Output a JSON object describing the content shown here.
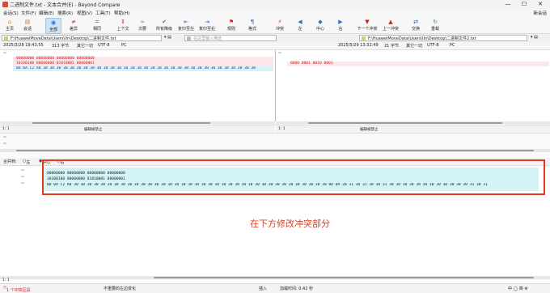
{
  "window": {
    "title": "二进制文件.txt - 文本合并(E) - Beyond Compare",
    "controls": [
      "—",
      "☐",
      "✕"
    ]
  },
  "menubar": {
    "items": [
      "会话(S)",
      "文件(F)",
      "编辑(E)",
      "搜索(R)",
      "视图(V)",
      "工具(T)",
      "帮助(H)"
    ],
    "right": "新会话"
  },
  "toolbar": {
    "buttons": [
      {
        "label": "主页",
        "icon": "home-icon",
        "glyph": "⌂"
      },
      {
        "label": "会话",
        "icon": "session-icon",
        "glyph": "▤"
      },
      {
        "label": "全部",
        "icon": "all-icon",
        "glyph": "◉"
      },
      {
        "label": "差异",
        "icon": "diff-icon",
        "glyph": "≠"
      },
      {
        "label": "相同",
        "icon": "same-icon",
        "glyph": "="
      },
      {
        "label": "上下文",
        "icon": "context-icon",
        "glyph": "⇕"
      },
      {
        "label": "次要",
        "icon": "minor-icon",
        "glyph": "≈"
      },
      {
        "label": "所有降级",
        "icon": "all-down-icon",
        "glyph": "✔"
      },
      {
        "label": "复印至左",
        "icon": "copy-left-icon",
        "glyph": "⇤"
      },
      {
        "label": "复印至右",
        "icon": "copy-right-icon",
        "glyph": "⇥"
      },
      {
        "label": "规则",
        "icon": "rules-icon",
        "glyph": "⚑"
      },
      {
        "label": "格式",
        "icon": "format-icon",
        "glyph": "¶"
      },
      {
        "label": "冲突",
        "icon": "conflict-icon",
        "glyph": "⚡"
      },
      {
        "label": "左",
        "icon": "left-icon",
        "glyph": "◀"
      },
      {
        "label": "中心",
        "icon": "center-icon",
        "glyph": "◆"
      },
      {
        "label": "右",
        "icon": "right-icon",
        "glyph": "▶"
      },
      {
        "label": "下一个冲突",
        "icon": "next-conflict-icon",
        "glyph": "▼"
      },
      {
        "label": "上一冲突",
        "icon": "prev-conflict-icon",
        "glyph": "▲"
      },
      {
        "label": "交换",
        "icon": "swap-icon",
        "glyph": "⇄"
      },
      {
        "label": "重载",
        "icon": "reload-icon",
        "glyph": "↻"
      }
    ],
    "active": "全部"
  },
  "left_file": {
    "path": "F:\\HuaweiMoveData\\Users\\lln\\Desktop\\二进制文件.txt",
    "date": "2025/3/28 19:43:55",
    "size": "313 字节",
    "other": "其它一切",
    "encoding": "UTF-8",
    "lineend": "PC",
    "lines": [
      {
        "text": "00000000 00000000 00000000 00000000",
        "cls": "red hl-pink"
      },
      {
        "text": "10100100 00000000 01010001 00000001",
        "cls": "red hl-pink"
      },
      {
        "text": "0D 0A C2 A0 30 30 30 30 30 30 30 30 30 30 30 30 30 30 30 30 30 30 30 30 30 30 30 30 30 30 30 30 30 30 30 30",
        "cls": "blue hl-cyan"
      }
    ],
    "cursor": "1: 1",
    "editstate": "编辑被禁止"
  },
  "filter": {
    "placeholder": "在这里输入筛选"
  },
  "right_file": {
    "path": "F:\\HuaweiMoveData\\Users\\lln\\Desktop\\二进制文件2.txt",
    "date": "2025/5/29 13:32:49",
    "size": "21 字节",
    "other": "其它一切",
    "encoding": "UTF-8",
    "lineend": "PC",
    "lines": [
      {
        "text": "0000 0001 0010 0001",
        "cls": "red hl-pink"
      }
    ],
    "cursor": "1: 1",
    "editstate": "编辑被禁止"
  },
  "merge": {
    "label": "合并到:",
    "options": [
      "左",
      "中心",
      "右"
    ],
    "selected": "中心",
    "lines": [
      "00000000 00000000 00000000 00000000",
      "10100100 00000000 01010001 00000001",
      "0D 0A C2 A0 30 30 30 30 30 30 30 30 30 30 30 30 30 30 30 30 30 30 30 30 30 30 30 30 30 30 30 30 30 30 30 30 30 30 30 30 30 30 0D 0A 20 31 30 31 30 30 31 30 30 30 30 30 30 30 30 30 30 30 30 31 30 31"
    ],
    "cursor": "1: 1"
  },
  "annotation": "在下方修改冲突部分",
  "status": {
    "conflicts": "1 个冲突区段",
    "important": "不重要的左边变化",
    "insert": "插入",
    "loadtime": "加载时间: 0.42 秒"
  },
  "colors": {
    "accent": "#e43a1c",
    "diff_red": "#d12020",
    "same_blue": "#1b3f96"
  }
}
